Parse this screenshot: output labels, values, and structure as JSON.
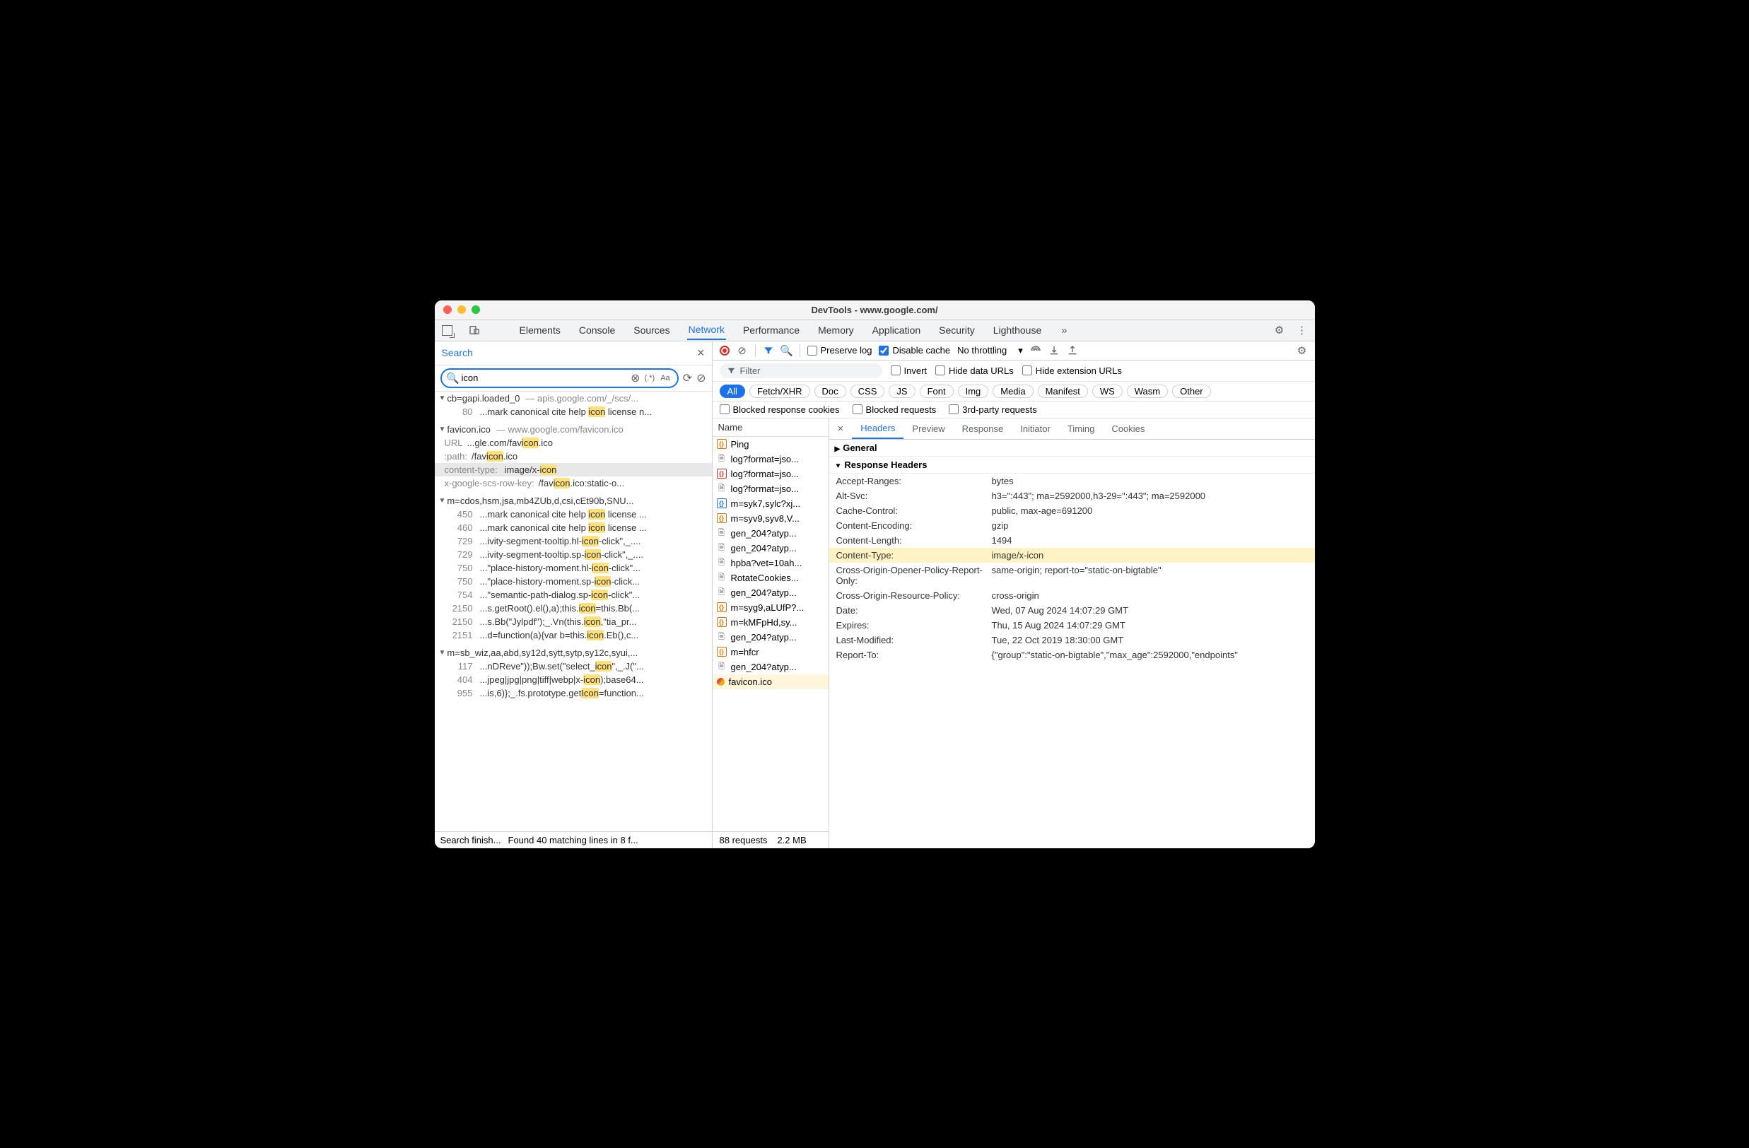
{
  "window": {
    "title": "DevTools - www.google.com/"
  },
  "tabs": {
    "items": [
      "Elements",
      "Console",
      "Sources",
      "Network",
      "Performance",
      "Memory",
      "Application",
      "Security",
      "Lighthouse"
    ],
    "active": "Network"
  },
  "search": {
    "title": "Search",
    "query": "icon",
    "regex_label": "(.*)",
    "case_label": "Aa",
    "files": [
      {
        "name": "cb=gapi.loaded_0",
        "path": "apis.google.com/_/scs/...",
        "matches": [
          {
            "ln": "80",
            "txt_pre": "...mark canonical cite help ",
            "hl": "icon",
            "txt_post": " license n..."
          }
        ]
      },
      {
        "name": "favicon.ico",
        "path": "www.google.com/favicon.ico",
        "kv": [
          {
            "k": "URL",
            "v_pre": "...gle.com/fav",
            "hl": "icon",
            "v_post": ".ico"
          },
          {
            "k": ":path:",
            "v_pre": "/fav",
            "hl": "icon",
            "v_post": ".ico"
          },
          {
            "k": "content-type:",
            "v_pre": "image/x-",
            "hl": "icon",
            "v_post": "",
            "sel": true
          },
          {
            "k": "x-google-scs-row-key:",
            "v_pre": "/fav",
            "hl": "icon",
            "v_post": ".ico:static-o..."
          }
        ]
      },
      {
        "name": "m=cdos,hsm,jsa,mb4ZUb,d,csi,cEt90b,SNU...",
        "path": "",
        "matches": [
          {
            "ln": "450",
            "txt_pre": "...mark canonical cite help ",
            "hl": "icon",
            "txt_post": " license ..."
          },
          {
            "ln": "460",
            "txt_pre": "...mark canonical cite help ",
            "hl": "icon",
            "txt_post": " license ..."
          },
          {
            "ln": "729",
            "txt_pre": "...ivity-segment-tooltip.hl-",
            "hl": "icon",
            "txt_post": "-click\",_...."
          },
          {
            "ln": "729",
            "txt_pre": "...ivity-segment-tooltip.sp-",
            "hl": "icon",
            "txt_post": "-click\",_...."
          },
          {
            "ln": "750",
            "txt_pre": "...\"place-history-moment.hl-",
            "hl": "icon",
            "txt_post": "-click\"..."
          },
          {
            "ln": "750",
            "txt_pre": "...\"place-history-moment.sp-",
            "hl": "icon",
            "txt_post": "-click..."
          },
          {
            "ln": "754",
            "txt_pre": "...\"semantic-path-dialog.sp-",
            "hl": "icon",
            "txt_post": "-click\"..."
          },
          {
            "ln": "2150",
            "txt_pre": "...s.getRoot().el(),a);this.",
            "hl": "icon",
            "txt_post": "=this.Bb(..."
          },
          {
            "ln": "2150",
            "txt_pre": "...s.Bb(\"Jylpdf\");_.Vn(this.",
            "hl": "icon",
            "txt_post": ",\"tia_pr..."
          },
          {
            "ln": "2151",
            "txt_pre": "...d=function(a){var b=this.",
            "hl": "icon",
            "txt_post": ".Eb(),c..."
          }
        ]
      },
      {
        "name": "m=sb_wiz,aa,abd,sy12d,sytt,sytp,sy12c,syui,...",
        "path": "",
        "matches": [
          {
            "ln": "117",
            "txt_pre": "...nDReve\"));Bw.set(\"select_",
            "hl": "icon",
            "txt_post": "\",_.J(\"..."
          },
          {
            "ln": "404",
            "txt_pre": "...jpeg|jpg|png|tiff|webp|x-",
            "hl": "icon",
            "txt_post": ");base64..."
          },
          {
            "ln": "955",
            "txt_pre": "...is,6)};_.fs.prototype.get",
            "hl": "Icon",
            "txt_post": "=function..."
          }
        ]
      }
    ],
    "status1": "Search finish...",
    "status2": "Found 40 matching lines in 8 f..."
  },
  "net_toolbar": {
    "preserve": "Preserve log",
    "disable": "Disable cache",
    "throttling": "No throttling"
  },
  "net_filter": {
    "placeholder": "Filter",
    "invert": "Invert",
    "hide_data": "Hide data URLs",
    "hide_ext": "Hide extension URLs"
  },
  "chips": [
    "All",
    "Fetch/XHR",
    "Doc",
    "CSS",
    "JS",
    "Font",
    "Img",
    "Media",
    "Manifest",
    "WS",
    "Wasm",
    "Other"
  ],
  "net_checks": {
    "blocked_cookies": "Blocked response cookies",
    "blocked_req": "Blocked requests",
    "third": "3rd-party requests"
  },
  "requests": {
    "header": "Name",
    "items": [
      {
        "ic": "script",
        "name": "Ping"
      },
      {
        "ic": "doc",
        "name": "log?format=jso..."
      },
      {
        "ic": "scriptr",
        "name": "log?format=jso..."
      },
      {
        "ic": "doc",
        "name": "log?format=jso..."
      },
      {
        "ic": "scriptb",
        "name": "m=syk7,sylc?xj..."
      },
      {
        "ic": "script",
        "name": "m=syv9,syv8,V..."
      },
      {
        "ic": "doc",
        "name": "gen_204?atyp..."
      },
      {
        "ic": "doc",
        "name": "gen_204?atyp..."
      },
      {
        "ic": "doc",
        "name": "hpba?vet=10ah..."
      },
      {
        "ic": "doc",
        "name": "RotateCookies..."
      },
      {
        "ic": "doc",
        "name": "gen_204?atyp..."
      },
      {
        "ic": "script",
        "name": "m=syg9,aLUfP?..."
      },
      {
        "ic": "script",
        "name": "m=kMFpHd,sy..."
      },
      {
        "ic": "doc",
        "name": "gen_204?atyp..."
      },
      {
        "ic": "script",
        "name": "m=hfcr"
      },
      {
        "ic": "doc",
        "name": "gen_204?atyp..."
      },
      {
        "ic": "fav",
        "name": "favicon.ico",
        "sel": true
      }
    ]
  },
  "detail_tabs": [
    "Headers",
    "Preview",
    "Response",
    "Initiator",
    "Timing",
    "Cookies"
  ],
  "general": "General",
  "resp_headers": "Response Headers",
  "headers": [
    {
      "k": "Accept-Ranges:",
      "v": "bytes"
    },
    {
      "k": "Alt-Svc:",
      "v": "h3=\":443\"; ma=2592000,h3-29=\":443\"; ma=2592000"
    },
    {
      "k": "Cache-Control:",
      "v": "public, max-age=691200"
    },
    {
      "k": "Content-Encoding:",
      "v": "gzip"
    },
    {
      "k": "Content-Length:",
      "v": "1494"
    },
    {
      "k": "Content-Type:",
      "v": "image/x-icon",
      "hl": true
    },
    {
      "k": "Cross-Origin-Opener-Policy-Report-Only:",
      "v": "same-origin; report-to=\"static-on-bigtable\""
    },
    {
      "k": "Cross-Origin-Resource-Policy:",
      "v": "cross-origin"
    },
    {
      "k": "Date:",
      "v": "Wed, 07 Aug 2024 14:07:29 GMT"
    },
    {
      "k": "Expires:",
      "v": "Thu, 15 Aug 2024 14:07:29 GMT"
    },
    {
      "k": "Last-Modified:",
      "v": "Tue, 22 Oct 2019 18:30:00 GMT"
    },
    {
      "k": "Report-To:",
      "v": "{\"group\":\"static-on-bigtable\",\"max_age\":2592000,\"endpoints\""
    }
  ],
  "net_status": {
    "reqs": "88 requests",
    "size": "2.2 MB"
  }
}
